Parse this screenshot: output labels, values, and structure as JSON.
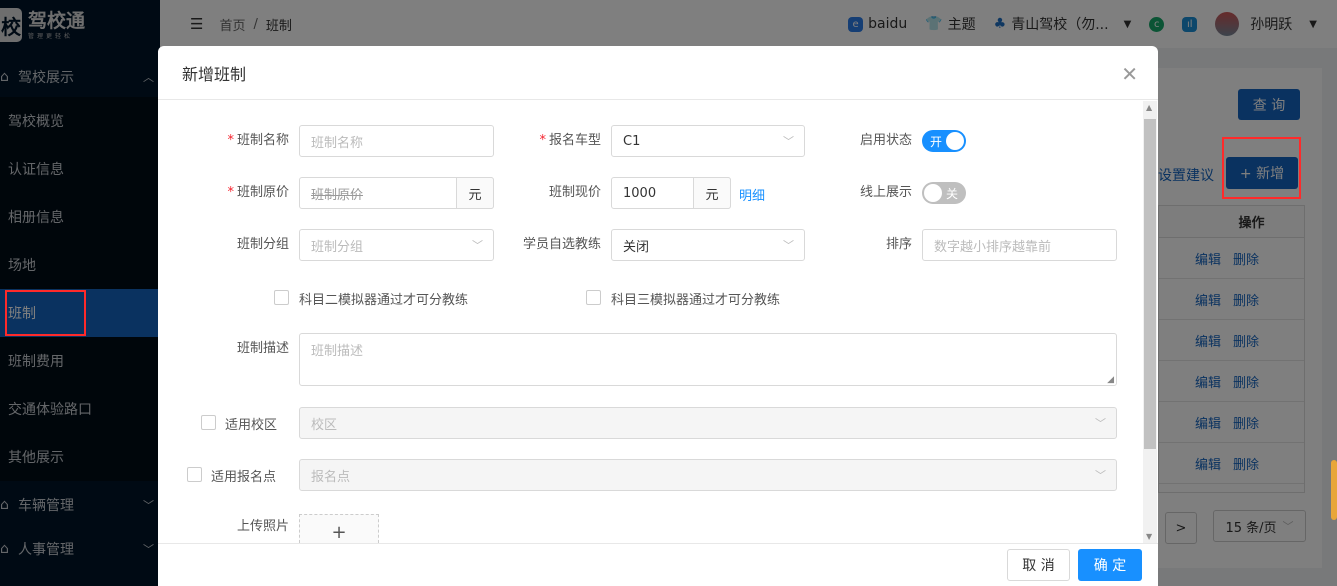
{
  "app": {
    "logo_mark": "校",
    "logo_title": "驾校通",
    "logo_slogan": "管理更轻松"
  },
  "sidebar": {
    "group_open": "驾校展示",
    "items": [
      {
        "label": "驾校概览"
      },
      {
        "label": "认证信息"
      },
      {
        "label": "相册信息"
      },
      {
        "label": "场地"
      },
      {
        "label": "班制",
        "active": true
      },
      {
        "label": "班制费用"
      },
      {
        "label": "交通体验路口"
      },
      {
        "label": "其他展示"
      }
    ],
    "groups": [
      {
        "label": "车辆管理"
      },
      {
        "label": "人事管理"
      }
    ]
  },
  "topbar": {
    "breadcrumb": [
      "首页",
      "班制"
    ],
    "separator": "/",
    "baidu": "baidu",
    "theme": "主题",
    "school": "青山驾校（勿...",
    "user": "孙明跃"
  },
  "page": {
    "query_button": "查 询",
    "settings_link": "设置建议",
    "add_button": "+ 新增",
    "table_header": "操作",
    "rows": [
      {
        "edit": "编辑",
        "del": "删除"
      },
      {
        "edit": "编辑",
        "del": "删除"
      },
      {
        "edit": "编辑",
        "del": "删除"
      },
      {
        "edit": "编辑",
        "del": "删除"
      },
      {
        "edit": "编辑",
        "del": "删除"
      },
      {
        "edit": "编辑",
        "del": "删除"
      }
    ],
    "next": ">",
    "page_size": "15 条/页"
  },
  "modal": {
    "title": "新增班制",
    "form": {
      "name_label": "班制名称",
      "name_placeholder": "班制名称",
      "car_type_label": "报名车型",
      "car_type_value": "C1",
      "enable_label": "启用状态",
      "enable_value": "开",
      "orig_price_label": "班制原价",
      "orig_price_placeholder": "班制原价",
      "unit": "元",
      "cur_price_label": "班制现价",
      "cur_price_value": "1000",
      "detail_link": "明细",
      "online_label": "线上展示",
      "online_value": "关",
      "group_label": "班制分组",
      "group_placeholder": "班制分组",
      "coach_label": "学员自选教练",
      "coach_value": "关闭",
      "sort_label": "排序",
      "sort_placeholder": "数字越小排序越靠前",
      "sub2_check": "科目二模拟器通过才可分教练",
      "sub3_check": "科目三模拟器通过才可分教练",
      "desc_label": "班制描述",
      "desc_placeholder": "班制描述",
      "campus_label": "适用校区",
      "campus_placeholder": "校区",
      "point_label": "适用报名点",
      "point_placeholder": "报名点",
      "photo_label": "上传照片",
      "photo_add": "+"
    },
    "cancel": "取 消",
    "ok": "确 定"
  },
  "colors": {
    "primary": "#1890ff",
    "sidebar": "#001529",
    "active": "#1565c0",
    "highlight": "#ff2a2a"
  }
}
